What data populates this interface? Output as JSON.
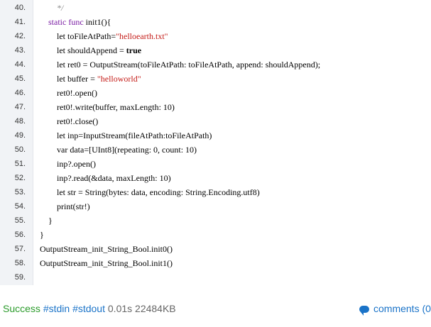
{
  "code": {
    "lines": [
      {
        "n": "40.",
        "t": "        */"
      },
      {
        "n": "41.",
        "t": "    static func init1(){"
      },
      {
        "n": "42.",
        "t": "        let toFileAtPath=\"helloearth.txt\""
      },
      {
        "n": "43.",
        "t": "        let shouldAppend = true"
      },
      {
        "n": "44.",
        "t": "        let ret0 = OutputStream(toFileAtPath: toFileAtPath, append: shouldAppend);"
      },
      {
        "n": "45.",
        "t": "        let buffer = \"helloworld\""
      },
      {
        "n": "46.",
        "t": "        ret0!.open()"
      },
      {
        "n": "47.",
        "t": "        ret0!.write(buffer, maxLength: 10)"
      },
      {
        "n": "48.",
        "t": "        ret0!.close()"
      },
      {
        "n": "49.",
        "t": "        let inp=InputStream(fileAtPath:toFileAtPath)"
      },
      {
        "n": "50.",
        "t": "        var data=[UInt8](repeating: 0, count: 10)"
      },
      {
        "n": "51.",
        "t": "        inp?.open()"
      },
      {
        "n": "52.",
        "t": "        inp?.read(&data, maxLength: 10)"
      },
      {
        "n": "53.",
        "t": "        let str = String(bytes: data, encoding: String.Encoding.utf8)"
      },
      {
        "n": "54.",
        "t": "        print(str!)"
      },
      {
        "n": "55.",
        "t": "    }"
      },
      {
        "n": "56.",
        "t": "}"
      },
      {
        "n": "57.",
        "t": "OutputStream_init_String_Bool.init0()"
      },
      {
        "n": "58.",
        "t": "OutputStream_init_String_Bool.init1()"
      },
      {
        "n": "59.",
        "t": ""
      }
    ]
  },
  "status": {
    "result": "Success",
    "tag1": "#stdin",
    "tag2": "#stdout",
    "time": "0.01s",
    "memory": "22484KB",
    "comments_label": "comments (0"
  }
}
